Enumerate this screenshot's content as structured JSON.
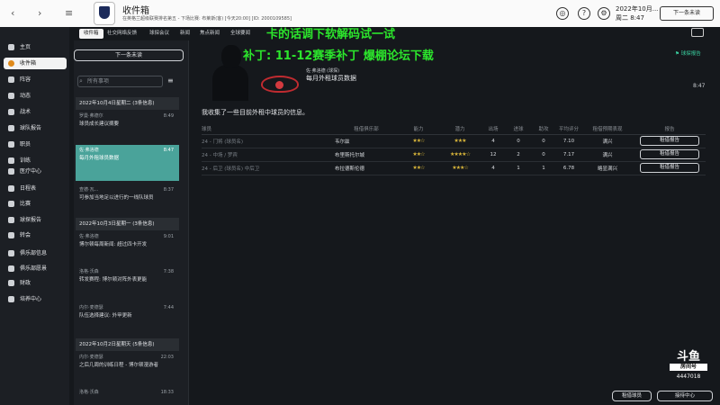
{
  "header": {
    "back": "‹",
    "forward": "›",
    "title": "收件箱",
    "subtitle": "在英格兰超级联赛排名第五 - 下场比赛: 布莱斯(客) [今天20:00] [ID: 2000109585]",
    "date_line1": "2022年10月...",
    "date_line2": "周二 8:47",
    "continue_label": "下一条未读"
  },
  "sidebar": {
    "items": [
      "主页",
      "收件箱",
      "阵容",
      "动态",
      "战术",
      "球队报告",
      "职员",
      "训练",
      "医疗中心",
      "日程表",
      "比赛",
      "球探报告",
      "转会",
      "俱乐部信息",
      "俱乐部愿景",
      "财政",
      "培养中心"
    ]
  },
  "tabs": [
    "收件箱",
    "社交网络反馈",
    "球探会议",
    "新闻",
    "焦点新闻",
    "全球要闻"
  ],
  "inbox": {
    "next_unread": "下一条未读",
    "search_placeholder": "所有事项",
    "groups": [
      {
        "title": "2022年10月4日星期二 (3条信息)",
        "messages": [
          {
            "from": "罗曼·弗德尔",
            "subject": "球员成长建议摘要",
            "time": "8:49"
          },
          {
            "from": "佐·弗洛德",
            "subject": "每月外租球员数据",
            "time": "8:47"
          },
          {
            "from": "查德·瓦...",
            "subject": "可参加当地足以进行的一线队球员",
            "time": "8:37"
          }
        ]
      },
      {
        "title": "2022年10月3日星期一 (3条信息)",
        "messages": [
          {
            "from": "佐·弗洛德",
            "subject": "博尔顿每周新闻: 超过四卡开发",
            "time": "9:01"
          },
          {
            "from": "洛格·沃森",
            "subject": "转发赛程: 博尔顿对阵外表更能",
            "time": "7:38"
          },
          {
            "from": "内尔·麦德瑟",
            "subject": "队伍选择建议: 外甲更新",
            "time": "7:44"
          }
        ]
      },
      {
        "title": "2022年10月2日星期天 (5条信息)",
        "messages": [
          {
            "from": "内尔·麦德瑟",
            "subject": "之后几周的训练日程 - 博尔顿漫游者",
            "time": "22:03"
          },
          {
            "from": "洛格·沃森",
            "subject": "",
            "time": "18:33"
          }
        ]
      }
    ]
  },
  "message": {
    "sender": "佐·弗洛德 (球探)",
    "subject": "每月外租球员数据",
    "scout_label": "球探报告",
    "time": "8:47",
    "body": "我收集了一些目前外租中球员的信息。"
  },
  "overlay": {
    "line1": "卡的话调下软解码试一试",
    "line2": "补丁: 11-12赛季补丁 爆棚论坛下载"
  },
  "table": {
    "headers": [
      "球员",
      "租借俱乐部",
      "能力",
      "潜力",
      "出场",
      "进球",
      "助攻",
      "平均评分",
      "租借预期表现",
      "报告"
    ],
    "rows": [
      {
        "player": "24 - 门将 (球员名)",
        "club": "韦尔兹",
        "ability": "★★☆",
        "potential": "★★★",
        "apps": "4",
        "goals": "0",
        "assists": "0",
        "rating": "7.10",
        "expect": "满兴",
        "report": "租借报告"
      },
      {
        "player": "24 - 中场 / 罗宾",
        "club": "布里斯托尔城",
        "ability": "★★☆",
        "potential": "★★★★☆",
        "apps": "12",
        "goals": "2",
        "assists": "0",
        "rating": "7.17",
        "expect": "满兴",
        "report": "租借报告"
      },
      {
        "player": "24 - 后卫 (球员名) 中后卫",
        "club": "布拉德斯伦德",
        "ability": "★★☆",
        "potential": "★★★☆",
        "apps": "4",
        "goals": "1",
        "assists": "1",
        "rating": "6.78",
        "expect": "略显满兴",
        "report": "租借报告"
      }
    ]
  },
  "footer": {
    "loan_player": "租借球员",
    "continue": "接待中心"
  },
  "watermark": {
    "brand": "斗鱼",
    "room": "房间号",
    "number": "4447018"
  }
}
